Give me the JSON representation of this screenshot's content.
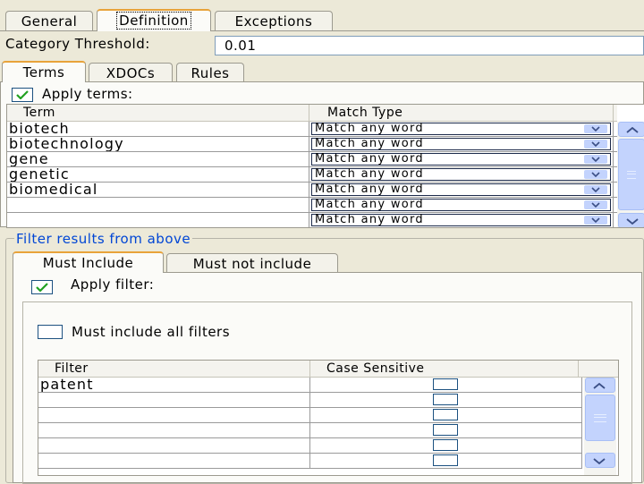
{
  "top_tabs": [
    {
      "label": "General"
    },
    {
      "label": "Definition"
    },
    {
      "label": "Exceptions"
    }
  ],
  "threshold": {
    "label": "Category Threshold:",
    "value": "0.01"
  },
  "sub_tabs": [
    {
      "label": "Terms"
    },
    {
      "label": "XDOCs"
    },
    {
      "label": "Rules"
    }
  ],
  "apply_terms": {
    "label": "Apply terms:",
    "checked": true
  },
  "terms_table": {
    "headers": [
      "Term",
      "Match Type"
    ],
    "rows": [
      {
        "term": "biotech",
        "match": "Match any word"
      },
      {
        "term": "biotechnology",
        "match": "Match any word"
      },
      {
        "term": "gene",
        "match": "Match any word"
      },
      {
        "term": "genetic",
        "match": "Match any word"
      },
      {
        "term": "biomedical",
        "match": "Match any word"
      },
      {
        "term": "",
        "match": "Match any word"
      },
      {
        "term": "",
        "match": "Match any word"
      }
    ]
  },
  "filter_group": {
    "legend": "Filter results from above"
  },
  "filter_tabs": [
    {
      "label": "Must Include"
    },
    {
      "label": "Must not include"
    }
  ],
  "apply_filter": {
    "label": "Apply filter:",
    "checked": true
  },
  "must_include_all": {
    "label": "Must include all filters",
    "checked": false
  },
  "filter_table": {
    "headers": [
      "Filter",
      "Case Sensitive"
    ],
    "rows": [
      {
        "filter": "patent"
      },
      {
        "filter": ""
      },
      {
        "filter": ""
      },
      {
        "filter": ""
      },
      {
        "filter": ""
      },
      {
        "filter": ""
      }
    ]
  },
  "icons": {
    "check": "check-icon",
    "combo_arrow": "chevron-down-icon",
    "scroll_up": "chevron-up-icon",
    "scroll_down": "chevron-down-icon"
  },
  "colors": {
    "accent_tab": "#e8a33a",
    "group_legend": "#0046d5",
    "scroll_blue": "#c3d3fd",
    "window_bg": "#ece9d8"
  }
}
